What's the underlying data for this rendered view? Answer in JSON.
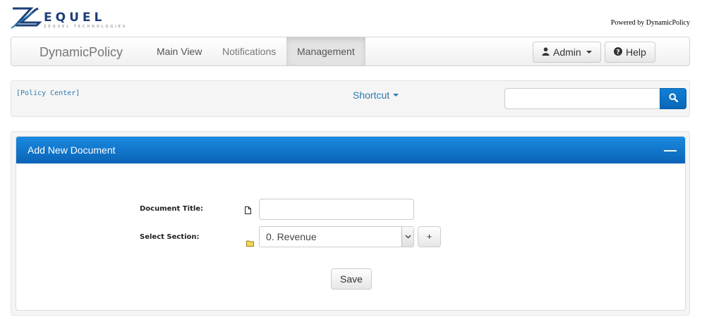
{
  "header": {
    "powered_by": "Powered by DynamicPolicy",
    "logo_alt": "ZEQUEL TECHNOLOGIES"
  },
  "navbar": {
    "brand": "DynamicPolicy",
    "items": [
      {
        "label": "Main View"
      },
      {
        "label": "Notifications"
      },
      {
        "label": "Management",
        "active": true
      }
    ],
    "admin_label": "Admin",
    "help_label": "Help"
  },
  "toolbar": {
    "policy_center": "[Policy Center]",
    "shortcut_label": "Shortcut",
    "search_placeholder": ""
  },
  "panel": {
    "title": "Add New Document",
    "collapse_symbol": "—",
    "document_title_label": "Document Title:",
    "document_title_value": "",
    "select_section_label": "Select Section:",
    "selected_section": "0. Revenue",
    "plus_label": "+",
    "save_label": "Save"
  },
  "colors": {
    "accent": "#0a67b8",
    "link": "#2a7ab0"
  }
}
